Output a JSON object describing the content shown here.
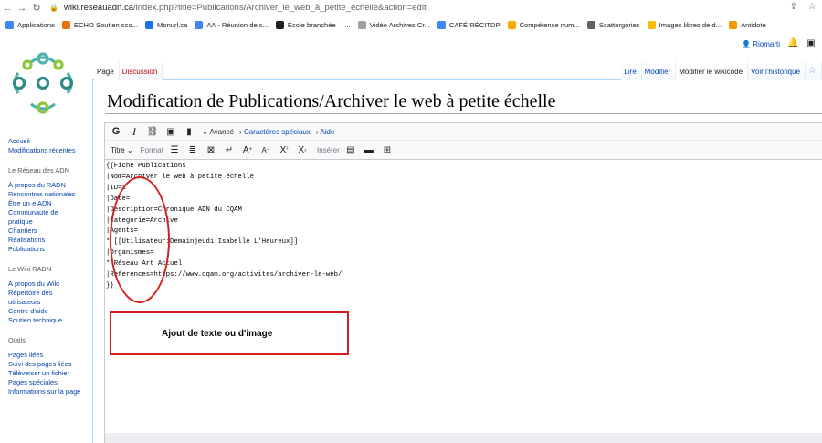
{
  "browser": {
    "url_domain": "wiki.reseauadn.ca",
    "url_path": "/index.php?title=Publications/Archiver_le_web_à_petite_échelle&action=edit",
    "bookmarks": [
      {
        "label": "Applications",
        "color": "#4285f4"
      },
      {
        "label": "ECHO Soutien sco...",
        "color": "#e8710a"
      },
      {
        "label": "Monurl.ca",
        "color": "#1a73e8"
      },
      {
        "label": "AA - Réunion de c...",
        "color": "#4285f4"
      },
      {
        "label": "École branchée —...",
        "color": "#202124"
      },
      {
        "label": "Vidéo Archives Cr...",
        "color": "#9aa0a6"
      },
      {
        "label": "CAFÉ RÉCITDP",
        "color": "#4285f4"
      },
      {
        "label": "Compétence num...",
        "color": "#f9ab00"
      },
      {
        "label": "Scattergories",
        "color": "#5f6368"
      },
      {
        "label": "Images libres de d...",
        "color": "#fbbc04"
      },
      {
        "label": "Antidote",
        "color": "#f29900"
      }
    ]
  },
  "wiki": {
    "user": "Riomarti",
    "tabs_left": [
      "Page",
      "Discussion"
    ],
    "tabs_right": [
      "Lire",
      "Modifier",
      "Modifier le wikicode",
      "Voir l'historique"
    ],
    "page_title": "Modification de Publications/Archiver le web à petite échelle",
    "sidebar": {
      "main_links": [
        "Accueil",
        "Modifications récentes"
      ],
      "section1": {
        "heading": "Le Réseau des ADN",
        "links": [
          "À propos du RADN",
          "Rencontres nationales",
          "Être un·e ADN",
          "Communauté de pratique",
          "Chantiers",
          "Réalisations",
          "Publications"
        ]
      },
      "section2": {
        "heading": "Le Wiki RADN",
        "links": [
          "À propos du Wiki",
          "Répertoire des utilisateurs",
          "Centre d'aide",
          "Soutien technique"
        ]
      },
      "section3": {
        "heading": "Outils",
        "links": [
          "Pages liées",
          "Suivi des pages liées",
          "Téléverser un fichier",
          "Pages spéciales",
          "Informations sur la page"
        ]
      }
    },
    "toolbar": {
      "advanced": "Avancé",
      "special_chars": "Caractères spéciaux",
      "help": "Aide",
      "heading_label": "Titre",
      "format_label": "Format",
      "insert_label": "Insérer"
    },
    "wikitext": [
      "{{Fiche Publications",
      "|Nom=Archiver le web à petite échelle",
      "|ID=1",
      "|Date=",
      "|Description=Chronique ADN du CQAM",
      "|Categorie=Archive",
      "|Agents=",
      "* [[Utilisateur:Demainjeudi|Isabelle L'Heureux]]",
      "|Organismes=",
      "* Réseau Art Actuel",
      "|References=https://www.cqam.org/activites/archiver-le-web/",
      "}}"
    ],
    "annotation_text": "Ajout de texte ou d'image",
    "annotation_color": "#d81e1e"
  }
}
